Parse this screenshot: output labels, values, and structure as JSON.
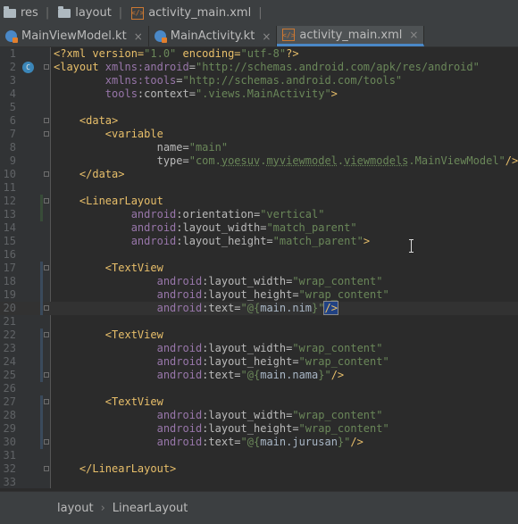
{
  "breadcrumb": {
    "items": [
      {
        "label": "res",
        "icon": "folder-icon"
      },
      {
        "label": "layout",
        "icon": "folder-icon"
      },
      {
        "label": "activity_main.xml",
        "icon": "xml-file-icon"
      }
    ]
  },
  "tabs": [
    {
      "label": "MainViewModel.kt",
      "icon": "kotlin-file-icon",
      "active": false
    },
    {
      "label": "MainActivity.kt",
      "icon": "kotlin-file-icon",
      "active": false
    },
    {
      "label": "activity_main.xml",
      "icon": "xml-file-icon",
      "active": true
    }
  ],
  "editor": {
    "lines": [
      {
        "n": "1",
        "segs": [
          [
            "t-decl",
            "<?xml version="
          ],
          [
            "t-val",
            "\"1.0\""
          ],
          [
            "t-decl",
            " encoding="
          ],
          [
            "t-val",
            "\"utf-8\""
          ],
          [
            "t-decl",
            "?>"
          ]
        ]
      },
      {
        "n": "2",
        "segs": [
          [
            "t-tag",
            "<layout "
          ],
          [
            "t-ns",
            "xmlns:"
          ],
          [
            "t-ns",
            "android"
          ],
          [
            "t-attr",
            "="
          ],
          [
            "t-val",
            "\"http://schemas.android.com/apk/res/android\""
          ]
        ]
      },
      {
        "n": "3",
        "segs": [
          [
            "t-attr",
            "        "
          ],
          [
            "t-ns",
            "xmlns:"
          ],
          [
            "t-ns",
            "tools"
          ],
          [
            "t-attr",
            "="
          ],
          [
            "t-val",
            "\"http://schemas.android.com/tools\""
          ]
        ]
      },
      {
        "n": "4",
        "segs": [
          [
            "t-attr",
            "        "
          ],
          [
            "t-ns",
            "tools"
          ],
          [
            "t-attr",
            ":context="
          ],
          [
            "t-val",
            "\".views.MainActivity\""
          ],
          [
            "t-tag",
            ">"
          ]
        ]
      },
      {
        "n": "5",
        "segs": []
      },
      {
        "n": "6",
        "segs": [
          [
            "t-attr",
            "    "
          ],
          [
            "t-tag",
            "<data>"
          ]
        ]
      },
      {
        "n": "7",
        "segs": [
          [
            "t-attr",
            "        "
          ],
          [
            "t-tag",
            "<variable"
          ]
        ]
      },
      {
        "n": "8",
        "segs": [
          [
            "t-attr",
            "                "
          ],
          [
            "t-attr",
            "name="
          ],
          [
            "t-val",
            "\"main\""
          ]
        ]
      },
      {
        "n": "9",
        "segs": [
          [
            "t-attr",
            "                "
          ],
          [
            "t-attr",
            "type="
          ],
          [
            "t-val",
            "\"com."
          ],
          [
            "t-val t-underline",
            "yoesuv"
          ],
          [
            "t-val",
            "."
          ],
          [
            "t-val t-underline",
            "myviewmodel"
          ],
          [
            "t-val",
            "."
          ],
          [
            "t-val t-underline",
            "viewmodels"
          ],
          [
            "t-val",
            ".MainViewModel\""
          ],
          [
            "t-tag",
            "/>"
          ]
        ]
      },
      {
        "n": "10",
        "segs": [
          [
            "t-attr",
            "    "
          ],
          [
            "t-tag",
            "</data>"
          ]
        ]
      },
      {
        "n": "11",
        "segs": []
      },
      {
        "n": "12",
        "segs": [
          [
            "t-attr",
            "    "
          ],
          [
            "t-tag",
            "<LinearLayout"
          ]
        ]
      },
      {
        "n": "13",
        "segs": [
          [
            "t-attr",
            "            "
          ],
          [
            "t-ns",
            "android"
          ],
          [
            "t-attr",
            ":orientation="
          ],
          [
            "t-val",
            "\"vertical\""
          ]
        ]
      },
      {
        "n": "14",
        "segs": [
          [
            "t-attr",
            "            "
          ],
          [
            "t-ns",
            "android"
          ],
          [
            "t-attr",
            ":layout_width="
          ],
          [
            "t-val",
            "\"match_parent\""
          ]
        ]
      },
      {
        "n": "15",
        "segs": [
          [
            "t-attr",
            "            "
          ],
          [
            "t-ns",
            "android"
          ],
          [
            "t-attr",
            ":layout_height="
          ],
          [
            "t-val",
            "\"match_parent\""
          ],
          [
            "t-tag",
            ">"
          ]
        ]
      },
      {
        "n": "16",
        "segs": []
      },
      {
        "n": "17",
        "segs": [
          [
            "t-attr",
            "        "
          ],
          [
            "t-tag",
            "<TextView"
          ]
        ]
      },
      {
        "n": "18",
        "segs": [
          [
            "t-attr",
            "                "
          ],
          [
            "t-ns",
            "android"
          ],
          [
            "t-attr",
            ":layout_width="
          ],
          [
            "t-val",
            "\"wrap_content\""
          ]
        ]
      },
      {
        "n": "19",
        "segs": [
          [
            "t-attr",
            "                "
          ],
          [
            "t-ns",
            "android"
          ],
          [
            "t-attr",
            ":layout_height="
          ],
          [
            "t-val",
            "\"wrap_content\""
          ]
        ]
      },
      {
        "n": "20",
        "segs": [
          [
            "t-attr",
            "                "
          ],
          [
            "t-ns",
            "android"
          ],
          [
            "t-attr",
            ":text="
          ],
          [
            "t-val",
            "\"@{"
          ],
          [
            "t-bind",
            "main.nim"
          ],
          [
            "t-val",
            "}\""
          ],
          [
            "t-tag caret-box",
            "/>"
          ]
        ],
        "current": true
      },
      {
        "n": "21",
        "segs": []
      },
      {
        "n": "22",
        "segs": [
          [
            "t-attr",
            "        "
          ],
          [
            "t-tag",
            "<TextView"
          ]
        ]
      },
      {
        "n": "23",
        "segs": [
          [
            "t-attr",
            "                "
          ],
          [
            "t-ns",
            "android"
          ],
          [
            "t-attr",
            ":layout_width="
          ],
          [
            "t-val",
            "\"wrap_content\""
          ]
        ]
      },
      {
        "n": "24",
        "segs": [
          [
            "t-attr",
            "                "
          ],
          [
            "t-ns",
            "android"
          ],
          [
            "t-attr",
            ":layout_height="
          ],
          [
            "t-val",
            "\"wrap_content\""
          ]
        ]
      },
      {
        "n": "25",
        "segs": [
          [
            "t-attr",
            "                "
          ],
          [
            "t-ns",
            "android"
          ],
          [
            "t-attr",
            ":text="
          ],
          [
            "t-val",
            "\"@{"
          ],
          [
            "t-bind",
            "main.nama"
          ],
          [
            "t-val",
            "}\""
          ],
          [
            "t-tag",
            "/>"
          ]
        ]
      },
      {
        "n": "26",
        "segs": []
      },
      {
        "n": "27",
        "segs": [
          [
            "t-attr",
            "        "
          ],
          [
            "t-tag",
            "<TextView"
          ]
        ]
      },
      {
        "n": "28",
        "segs": [
          [
            "t-attr",
            "                "
          ],
          [
            "t-ns",
            "android"
          ],
          [
            "t-attr",
            ":layout_width="
          ],
          [
            "t-val",
            "\"wrap_content\""
          ]
        ]
      },
      {
        "n": "29",
        "segs": [
          [
            "t-attr",
            "                "
          ],
          [
            "t-ns",
            "android"
          ],
          [
            "t-attr",
            ":layout_height="
          ],
          [
            "t-val",
            "\"wrap_content\""
          ]
        ]
      },
      {
        "n": "30",
        "segs": [
          [
            "t-attr",
            "                "
          ],
          [
            "t-ns",
            "android"
          ],
          [
            "t-attr",
            ":text="
          ],
          [
            "t-val",
            "\"@{"
          ],
          [
            "t-bind",
            "main.jurusan"
          ],
          [
            "t-val",
            "}\""
          ],
          [
            "t-tag",
            "/>"
          ]
        ]
      },
      {
        "n": "31",
        "segs": []
      },
      {
        "n": "32",
        "segs": [
          [
            "t-attr",
            "    "
          ],
          [
            "t-tag",
            "</LinearLayout>"
          ]
        ]
      },
      {
        "n": "33",
        "segs": []
      }
    ]
  },
  "status_breadcrumb": [
    "layout",
    "LinearLayout"
  ],
  "colors": {
    "accent": "#4a88c7",
    "background": "#2b2b2b"
  }
}
